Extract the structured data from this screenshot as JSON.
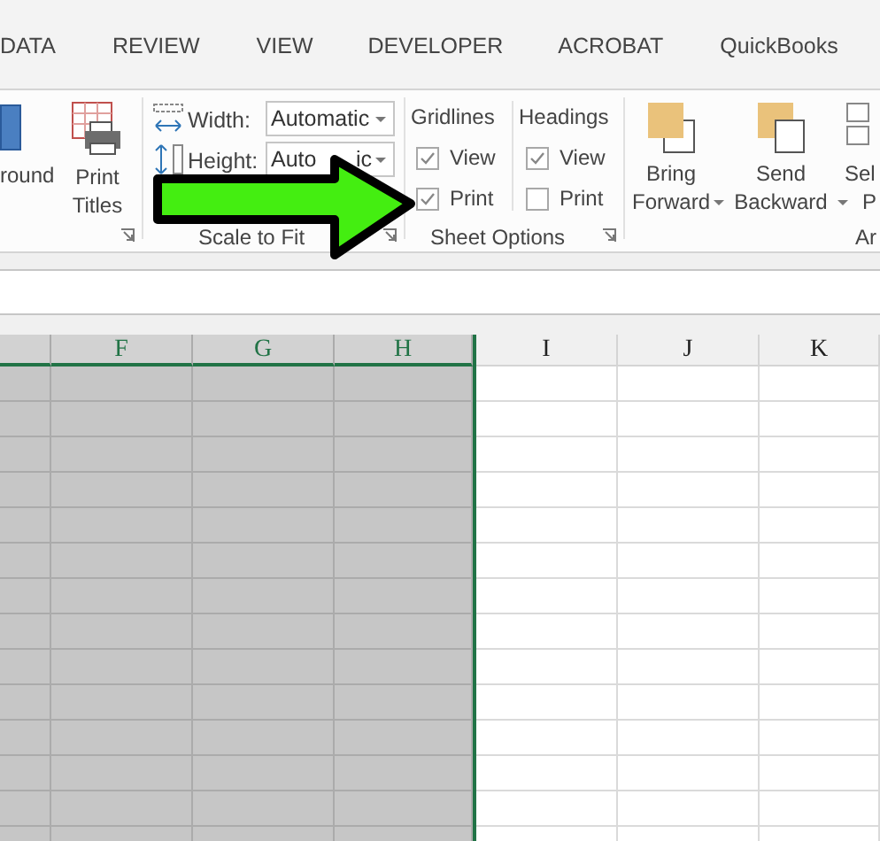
{
  "tabs": [
    {
      "label": "DATA",
      "selected": false
    },
    {
      "label": "REVIEW",
      "selected": false
    },
    {
      "label": "VIEW",
      "selected": false
    },
    {
      "label": "DEVELOPER",
      "selected": false
    },
    {
      "label": "ACROBAT",
      "selected": false
    },
    {
      "label": "QuickBooks",
      "selected": false
    }
  ],
  "page_setup": {
    "background_label": "round",
    "print_titles_label": "Print Titles"
  },
  "scale_to_fit": {
    "title": "Scale to Fit",
    "width_label": "Width:",
    "width_value": "Automatic",
    "height_label": "Height:",
    "height_value": "Auto",
    "height_value_tail": "ic"
  },
  "sheet_options": {
    "title": "Sheet Options",
    "gridlines": {
      "heading": "Gridlines",
      "view": {
        "label": "View",
        "checked": true
      },
      "print": {
        "label": "Print",
        "checked": true
      }
    },
    "headings": {
      "heading": "Headings",
      "view": {
        "label": "View",
        "checked": true
      },
      "print": {
        "label": "Print",
        "checked": false
      }
    }
  },
  "arrange": {
    "buttons": [
      {
        "label": "Bring Forward"
      },
      {
        "label": "Send Backward"
      },
      {
        "label": "Sel P"
      }
    ],
    "title": "Ar"
  },
  "columns": [
    {
      "label": "F",
      "selected": true
    },
    {
      "label": "G",
      "selected": true
    },
    {
      "label": "H",
      "selected": true
    },
    {
      "label": "I",
      "selected": false
    },
    {
      "label": "J",
      "selected": false
    },
    {
      "label": "K",
      "selected": false
    }
  ]
}
